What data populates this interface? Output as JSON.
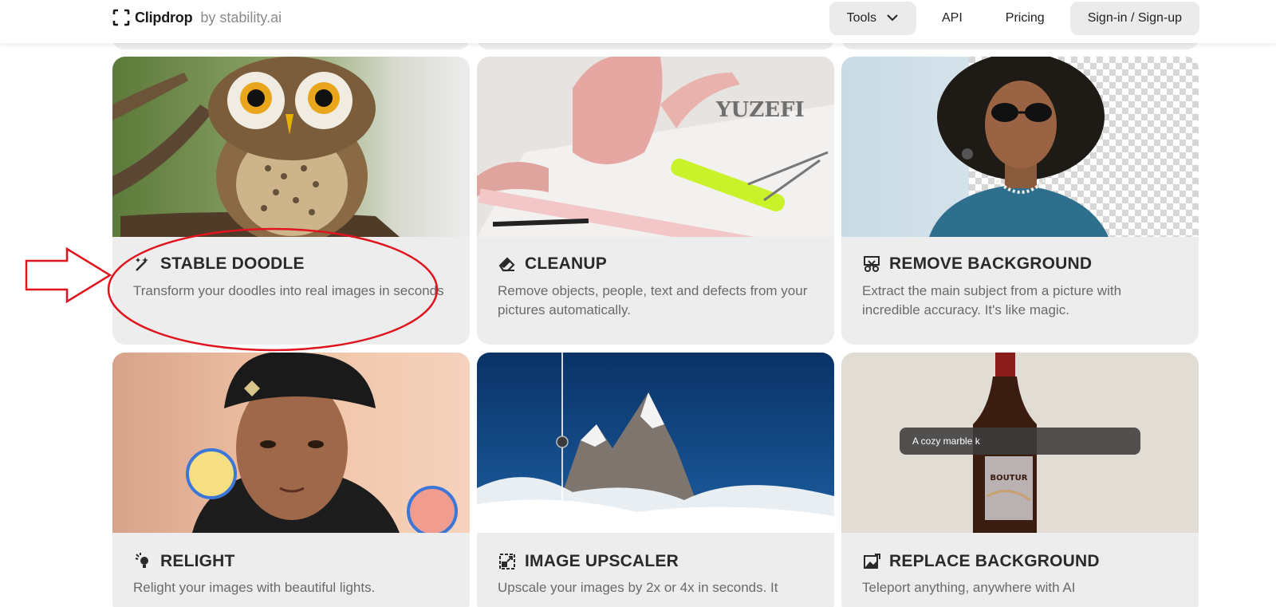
{
  "header": {
    "logo_text": "Clipdrop",
    "logo_by": "by stability.ai",
    "tools_label": "Tools",
    "api_label": "API",
    "pricing_label": "Pricing",
    "signin_label": "Sign-in / Sign-up"
  },
  "cards": [
    {
      "title": "STABLE DOODLE",
      "description": "Transform your doodles into real images in seconds"
    },
    {
      "title": "CLEANUP",
      "description": "Remove objects, people, text and defects from your pictures automatically."
    },
    {
      "title": "REMOVE BACKGROUND",
      "description": "Extract the main subject from a picture with incredible accuracy. It's like magic."
    },
    {
      "title": "RELIGHT",
      "description": "Relight your images with beautiful lights."
    },
    {
      "title": "IMAGE UPSCALER",
      "description": "Upscale your images by 2x or 4x in seconds. It"
    },
    {
      "title": "REPLACE BACKGROUND",
      "description": "Teleport anything, anywhere with AI"
    }
  ],
  "replace_bg_prompt": "A cozy marble k",
  "colors": {
    "annotation": "#e0141e",
    "card_bg": "#ededed",
    "upscaler_sky": "#0f3d78"
  }
}
